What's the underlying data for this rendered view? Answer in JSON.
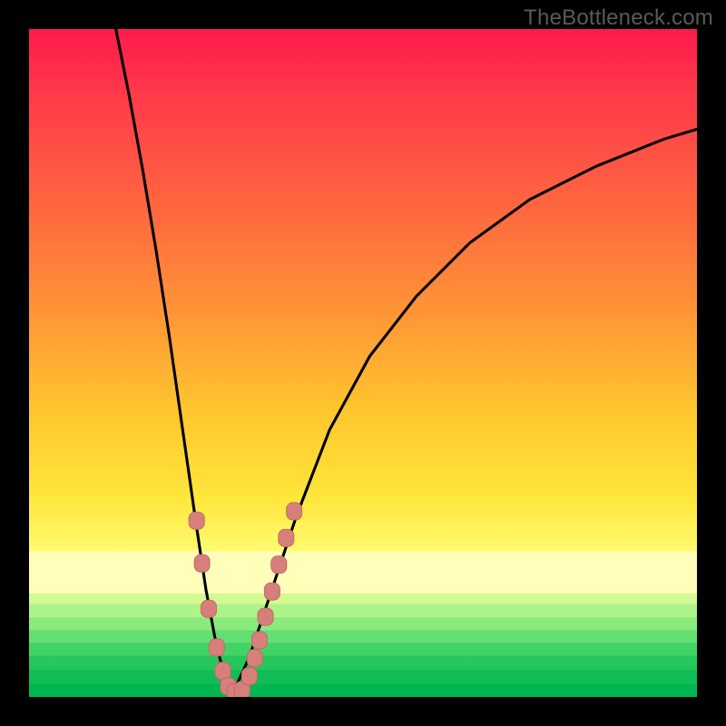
{
  "watermark": "TheBottleneck.com",
  "colors": {
    "background": "#000000",
    "curve": "#000000",
    "marker_fill": "#d77f7b",
    "marker_stroke": "#c46a66"
  },
  "chart_data": {
    "type": "line",
    "title": "",
    "xlabel": "",
    "ylabel": "",
    "xlim": [
      0,
      100
    ],
    "ylim": [
      0,
      100
    ],
    "curves": [
      {
        "name": "left",
        "x": [
          13,
          15,
          17,
          19,
          21,
          23,
          25,
          26.5,
          28,
          29.3,
          30.5
        ],
        "y": [
          100,
          90,
          79,
          67,
          54,
          40,
          26,
          16,
          8,
          3,
          0.5
        ]
      },
      {
        "name": "right",
        "x": [
          30.5,
          33,
          36,
          40,
          45,
          51,
          58,
          66,
          75,
          85,
          95,
          100
        ],
        "y": [
          0.5,
          6,
          15,
          27,
          40,
          51,
          60,
          68,
          74.5,
          79.5,
          83.5,
          85
        ]
      }
    ],
    "markers": {
      "name": "highlighted-points",
      "points": [
        {
          "x": 25.1,
          "y": 26.4
        },
        {
          "x": 25.9,
          "y": 20.0
        },
        {
          "x": 26.9,
          "y": 13.2
        },
        {
          "x": 28.1,
          "y": 7.4
        },
        {
          "x": 29.0,
          "y": 3.9
        },
        {
          "x": 29.8,
          "y": 1.6
        },
        {
          "x": 30.8,
          "y": 0.7
        },
        {
          "x": 31.9,
          "y": 1.0
        },
        {
          "x": 33.0,
          "y": 3.1
        },
        {
          "x": 33.8,
          "y": 5.8
        },
        {
          "x": 34.5,
          "y": 8.5
        },
        {
          "x": 35.4,
          "y": 12.0
        },
        {
          "x": 36.4,
          "y": 15.8
        },
        {
          "x": 37.4,
          "y": 19.8
        },
        {
          "x": 38.5,
          "y": 23.8
        },
        {
          "x": 39.7,
          "y": 27.8
        }
      ]
    }
  }
}
